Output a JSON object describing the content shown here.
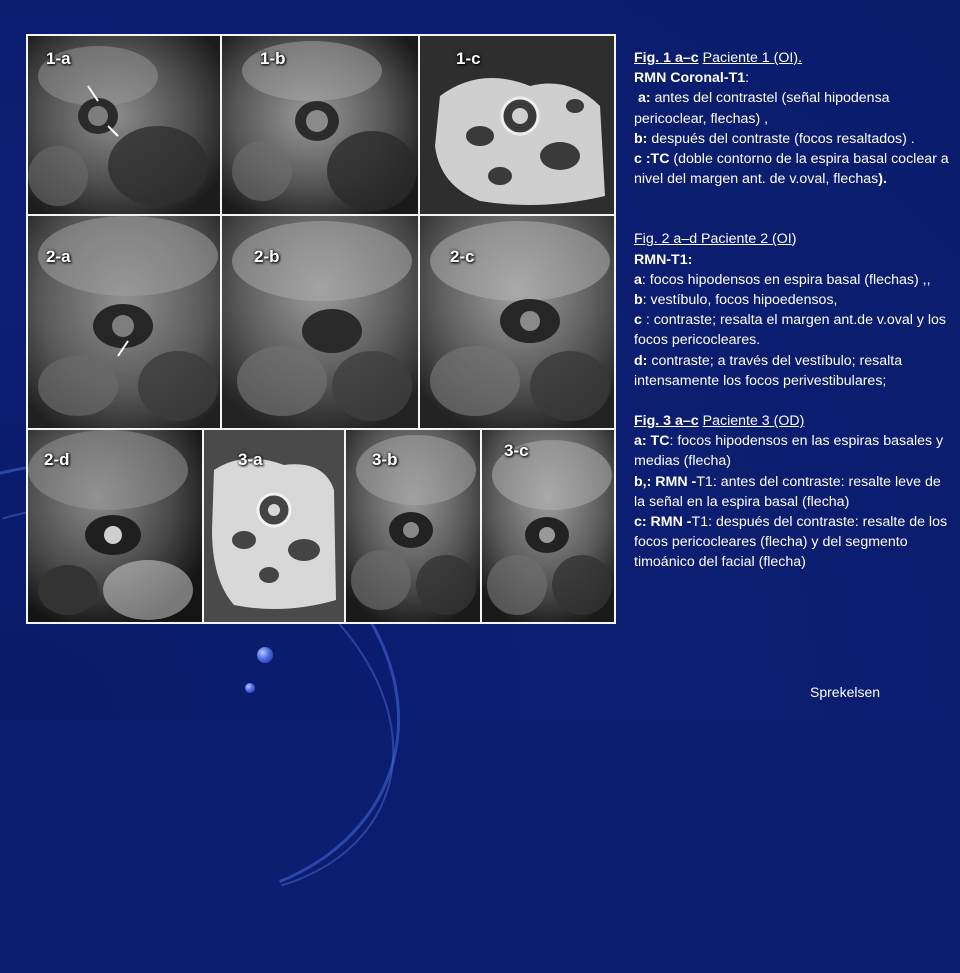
{
  "figures": {
    "labels": {
      "p1a": "1-a",
      "p1b": "1-b",
      "p1c": "1-c",
      "p2a": "2-a",
      "p2b": "2-b",
      "p2c": "2-c",
      "p2d": "2-d",
      "p3a": "3-a",
      "p3b": "3-b",
      "p3c": "3-c"
    }
  },
  "fig1": {
    "title": "Fig. 1 a–c",
    "patient": "Paciente 1 (OI).",
    "technique": "RMN Coronal-T1",
    "colon": ":",
    "a_key": "a:",
    "a_text": " antes del contrastel (señal hipodensa pericoclear, flechas) ,",
    "b_key": "b:",
    "b_text": " después del contraste (focos resaltados) .",
    "c_key": "c :TC",
    "c_text": " (doble contorno de la espira basal coclear a nivel del margen ant. de v.oval, flechas",
    "c_end": ")."
  },
  "fig2": {
    "title": "Fig. 2 a–d Paciente 2 (OI",
    "title_end": ")",
    "technique": "RMN-T1:",
    "a_key": "a",
    "a_text": ": focos hipodensos en espira basal (flechas) ,,",
    "b_key": "b",
    "b_text": ": vestíbulo, focos hipoedensos,",
    "c_key": "c",
    "c_text": " : contraste; resalta el margen ant.de v.oval y los focos pericocleares.",
    "d_key": "d:",
    "d_text": " contraste;  a través del vestíbulo; resalta intensamente los focos perivestibulares;"
  },
  "fig3": {
    "title": "Fig. 3 a–c",
    "patient": "Paciente 3 (OD)",
    "a_key": "a: TC",
    "a_text": ": focos hipodensos en las espiras basales y medias (flecha)",
    "b_key": "b,: RMN -",
    "b_text": "T1: antes del contraste: resalte leve de la señal en la espira basal (flecha)",
    "c_key": "c: RMN -",
    "c_text": "T1: después del contraste: resalte de los focos pericocleares (flecha) y del segmento timoánico del facial (flecha)"
  },
  "author": "Sprekelsen"
}
